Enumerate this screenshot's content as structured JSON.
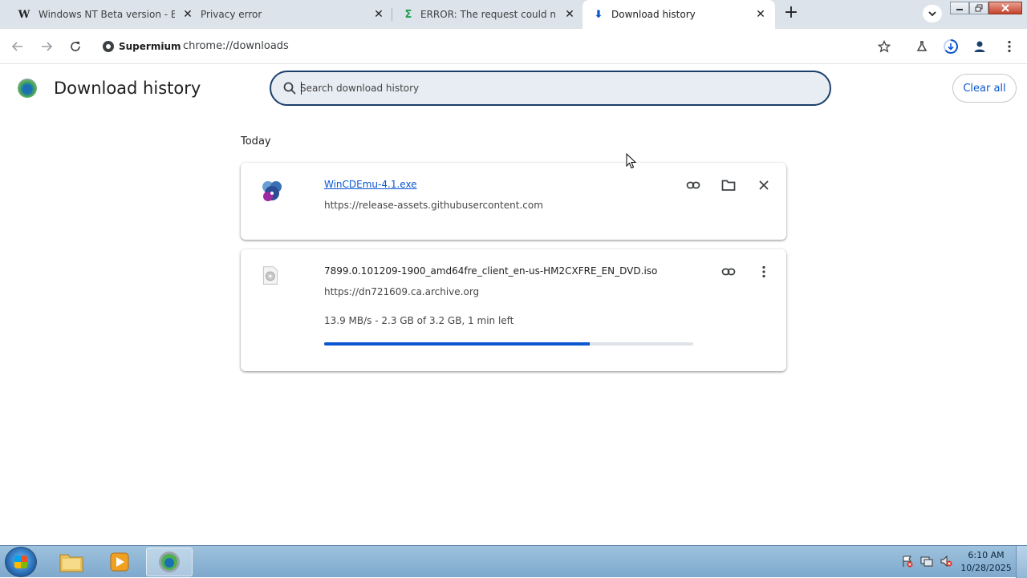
{
  "tabs": [
    {
      "title": "Windows NT Beta version - Beta",
      "icon": "W",
      "close": "✕"
    },
    {
      "title": "Privacy error",
      "icon": "",
      "close": "✕"
    },
    {
      "title": "ERROR: The request could not be satisfied",
      "icon": "Σ",
      "close": "✕"
    },
    {
      "title": "Download history",
      "icon": "⬇",
      "close": "✕"
    }
  ],
  "new_tab": "+",
  "toolbar": {
    "chip_label": "Supermium",
    "url": "chrome://downloads"
  },
  "page": {
    "title": "Download history",
    "search_placeholder": "Search download history",
    "clear_all": "Clear all",
    "day_label": "Today"
  },
  "downloads": [
    {
      "file_name": "WinCDEmu-4.1.exe",
      "source": "https://release-assets.githubusercontent.com"
    },
    {
      "file_name": "7899.0.101209-1900_amd64fre_client_en-us-HM2CXFRE_EN_DVD.iso",
      "source": "https://dn721609.ca.archive.org",
      "status": "13.9 MB/s - 2.3 GB of 3.2 GB, 1 min left",
      "progress": 0.72
    }
  ],
  "taskbar": {
    "time": "6:10 AM",
    "date": "10/28/2025"
  },
  "colors": {
    "accent": "#0b57d0",
    "tabstrip": "#dde3ea",
    "search_border": "#1a3f6b"
  }
}
